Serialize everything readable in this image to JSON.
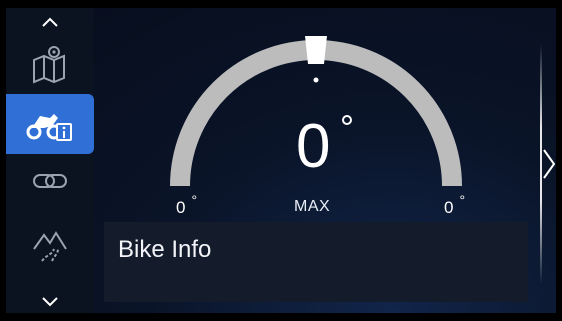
{
  "sidebar": {
    "items": [
      {
        "icon": "chevron-up-icon"
      },
      {
        "icon": "map-pin-icon"
      },
      {
        "icon": "motorcycle-info-icon",
        "active": true
      },
      {
        "icon": "link-icon"
      },
      {
        "icon": "mountain-road-icon"
      },
      {
        "icon": "chevron-down-icon"
      }
    ]
  },
  "gauge": {
    "lean_left": "0",
    "lean_right": "0",
    "degree_symbol": "°",
    "current_value": "0",
    "max_label": "MAX"
  },
  "info_panel": {
    "title": "Bike Info"
  },
  "colors": {
    "active_accent": "#2f6fd6",
    "arc": "#b9b9b9",
    "background": "#0a1428"
  }
}
